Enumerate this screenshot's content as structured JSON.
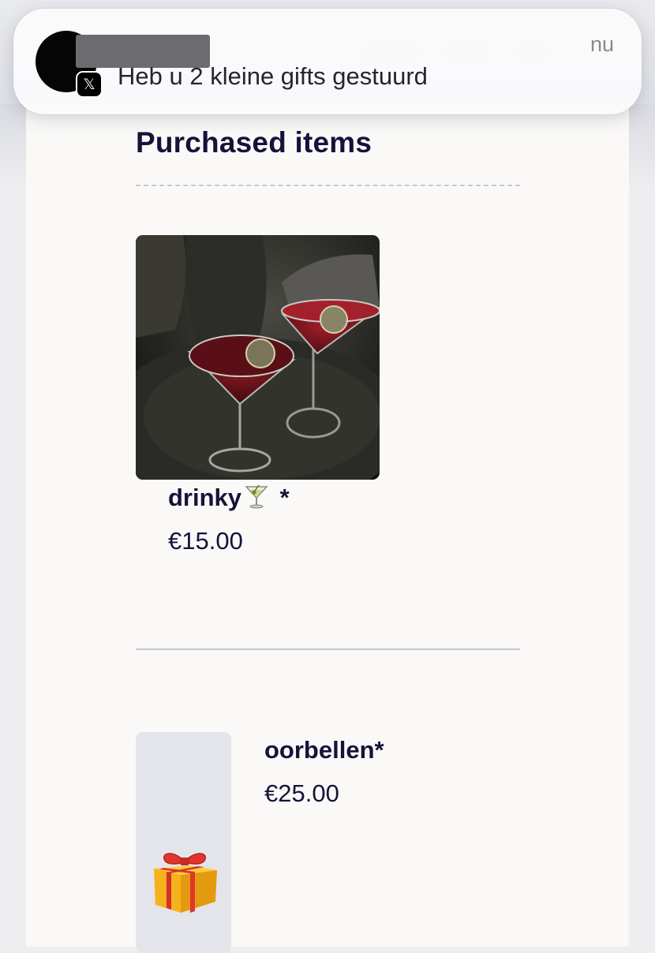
{
  "notification": {
    "message": "Heb u 2 kleine gifts gestuurd",
    "time": "nu",
    "app_icon": "x-logo-icon",
    "app_icon_glyph": "𝕏"
  },
  "section": {
    "title": "Purchased items"
  },
  "items": [
    {
      "name": "drinky",
      "name_suffix": " *",
      "price": "€15.00",
      "image": "cocktail-photo",
      "emoji_icon": "cocktail-glass-icon"
    },
    {
      "name": "oorbellen*",
      "price": "€25.00",
      "image": "gift-placeholder",
      "emoji_icon": "gift-icon"
    }
  ],
  "colors": {
    "text_primary": "#15133a",
    "card_background": "#faf9f8",
    "divider": "#c9c9cc",
    "placeholder_background": "#e4e5ea"
  }
}
